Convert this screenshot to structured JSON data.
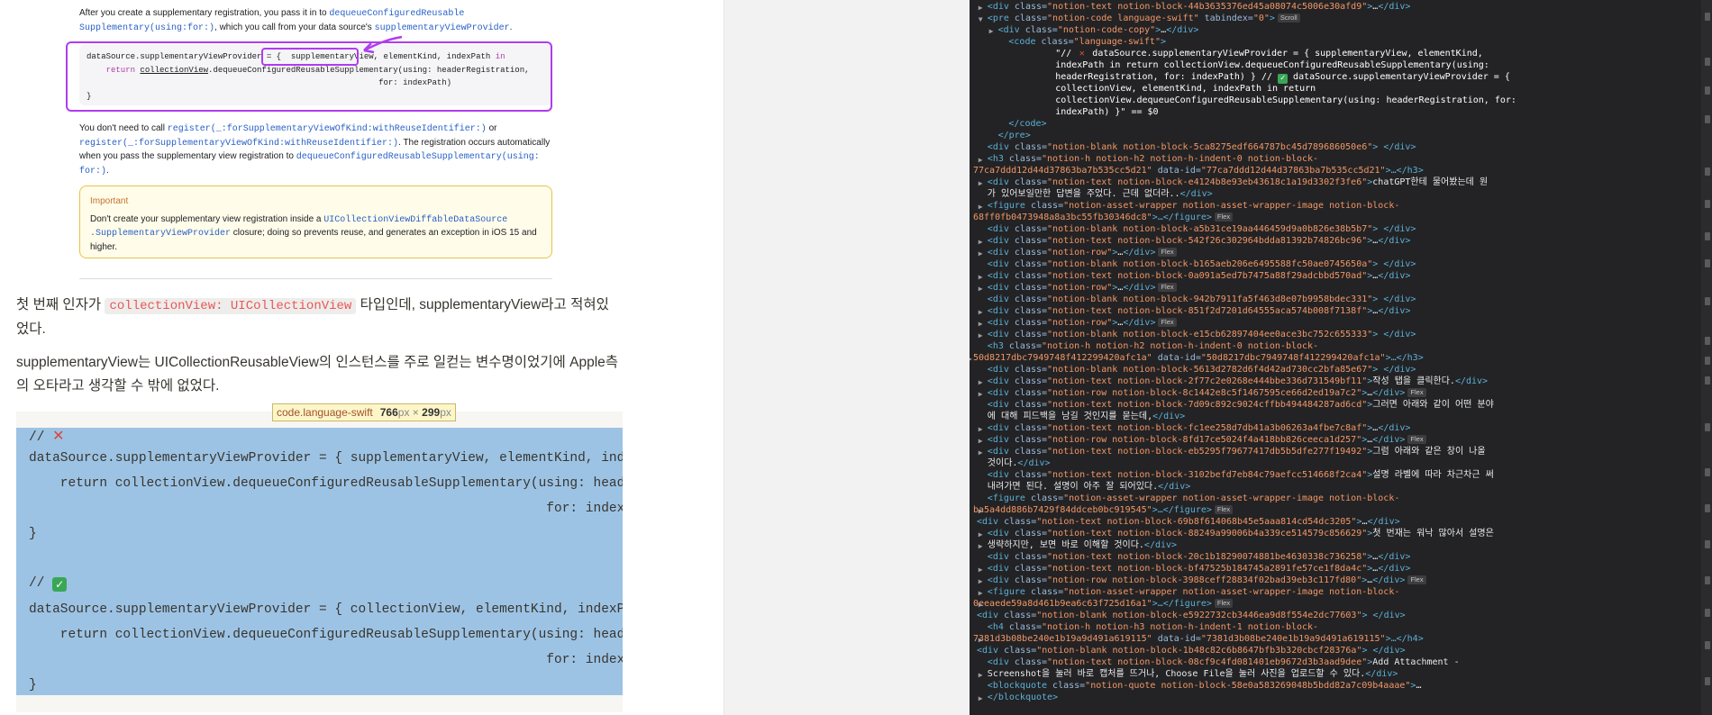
{
  "article": {
    "para1_a": "After you create a supplementary registration, you pass it in to ",
    "para1_link1": "dequeueConfiguredReusable",
    "para1_link1b": "Supplementary(using:for:)",
    "para1_b": ", which you call from your data source's ",
    "para1_link2": "supplementaryViewProvider",
    "para1_c": ".",
    "code_line1_a": "dataSource.supplementaryViewProvider = { ",
    "code_line1_hl": "supplementaryView,",
    "code_line1_b": " elementKind, indexPath ",
    "code_line1_kw": "in",
    "code_line2_kw": "return",
    "code_line2_u": "collectionView",
    "code_line2_b": ".dequeueConfiguredReusableSupplementary(using: headerRegistration,",
    "code_line3": "for: indexPath)",
    "code_line4": "}",
    "para2_a": "You don't need to call ",
    "para2_link1": "register(_:forSupplementaryViewOfKind:withReuseIdentifier:)",
    "para2_b": " or",
    "para2_link2": "register(_:forSupplementaryViewOfKind:withReuseIdentifier:)",
    "para2_c": ". The registration occurs automatically when you pass the supplementary view registration to ",
    "para2_link3": "dequeueConfiguredReusableSupplementary(using:",
    "para2_link3b": "for:)",
    "para2_d": ".",
    "important_title": "Important",
    "important_a": "Don't create your supplementary view registration inside a ",
    "important_link": "UICollectionViewDiffableDataSource",
    "important_link2": ".SupplementaryViewProvider",
    "important_b": " closure; doing so prevents reuse, and generates an exception in iOS 15 and higher.",
    "ko1_a": "첫 번째 인자가 ",
    "ko1_code": "collectionView: UICollectionView",
    "ko1_b": " 타입인데, supplementaryView라고 적혀있었다.",
    "ko2": "supplementaryView는 UICollectionReusableView의 인스턴스를 주로 일컫는 변수명이었기에 Apple측의 오타라고 생각할 수 밖에 없었다.",
    "big_code": {
      "l1_comment": "// ",
      "l2": "dataSource.supplementaryViewProvider = { supplementaryView, elementKind, indexPath in",
      "l3": "    return collectionView.dequeueConfiguredReusableSupplementary(using: headerRegistration,",
      "l4": "                                                                  for: indexPath)",
      "l5": "}",
      "l7_comment": "// ",
      "l8": "dataSource.supplementaryViewProvider = { collectionView, elementKind, indexPath in",
      "l9": "    return collectionView.dequeueConfiguredReusableSupplementary(using: headerRegistration,",
      "l10": "                                                                  for: indexPath)",
      "l11": "}"
    },
    "tooltip_selector": "code.language-swift",
    "tooltip_w": "766",
    "tooltip_h": "299",
    "tooltip_unit": "px",
    "tooltip_x": "×"
  },
  "devtools": {
    "icons": [
      "x-emoji-icon",
      "check-emoji-icon",
      "expand-triangle-icon",
      "collapse-triangle-icon"
    ],
    "colors": {
      "panel_bg": "#232325",
      "selection": "#0c4bb6",
      "tag": "#5db0d7",
      "attr_name": "#9bbbdc",
      "attr_value": "#f29766"
    },
    "lines": [
      {
        "pre": "<div ",
        "cls": "notion-text notion-block-44b3635376ed45a08074c5006e30afd9",
        "post": ">…</div>"
      },
      {
        "pre": "<pre ",
        "cls": "notion-code language-swift",
        "extra": " tabindex=\"0\">",
        "chip": "scroll"
      },
      {
        "pre": "<div ",
        "cls": "notion-code-copy",
        "post": ">…</div>"
      },
      {
        "pre": "<code ",
        "cls": "language-swift",
        "post": ">"
      },
      {
        "sel": "\"// ",
        "sel_b": " dataSource.supplementaryViewProvider = { supplementaryView, elementKind,"
      },
      {
        "sel": "indexPath in return collectionView.dequeueConfiguredReusableSupplementary(using:"
      },
      {
        "sel": "headerRegistration, for: indexPath) } // ",
        "sel_b": " dataSource.supplementaryViewProvider = {"
      },
      {
        "sel": "collectionView, elementKind, indexPath in return"
      },
      {
        "sel": "collectionView.dequeueConfiguredReusableSupplementary(using: headerRegistration, for:"
      },
      {
        "sel": "indexPath) }\" == $0"
      },
      {
        "close": "</code>"
      },
      {
        "close": "</pre>"
      },
      {
        "pre": "<div ",
        "cls": "notion-blank notion-block-5ca8275edf664787bc45d789686050e6",
        "post": "> </div>"
      },
      {
        "pre": "<h3 ",
        "cls": "notion-h notion-h2 notion-h-indent-0 notion-block-"
      },
      {
        "cont": "77ca7ddd12d44d37863ba7b535cc5d21",
        "extra_attr": " data-id=",
        "extra_val": "\"77ca7ddd12d44d37863ba7b535cc5d21\"",
        "post": ">…</h3>"
      },
      {
        "pre": "<div ",
        "cls": "notion-text notion-block-e4124b8e93eb43618c1a19d3302f3fe6",
        "post": ">chatGPT한테 물어봤는데 원"
      },
      {
        "text": "가 있어보일만한 답변을 주었다. 근데 없더라..</div>"
      },
      {
        "pre": "<figure ",
        "cls": "notion-asset-wrapper notion-asset-wrapper-image notion-block-"
      },
      {
        "cont": "68ff0fb0473948a8a3bc55fb30346dc8",
        "post": ">…</figure>",
        "chip": "flex"
      },
      {
        "pre": "<div ",
        "cls": "notion-blank notion-block-a5b31ce19aa446459d9a0b826e38b5b7",
        "post": "> </div>"
      },
      {
        "pre": "<div ",
        "cls": "notion-text notion-block-542f26c302964bdda81392b74826bc96",
        "post": ">…</div>"
      },
      {
        "pre": "<div ",
        "cls": "notion-row",
        "post": ">…</div>",
        "chip": "flex"
      },
      {
        "pre": "<div ",
        "cls": "notion-blank notion-block-b165aeb206e6495588fc50ae0745650a",
        "post": "> </div>"
      },
      {
        "pre": "<div ",
        "cls": "notion-text notion-block-0a091a5ed7b7475a88f29adcbbd570ad",
        "post": ">…</div>"
      },
      {
        "pre": "<div ",
        "cls": "notion-row",
        "post": ">…</div>",
        "chip": "flex"
      },
      {
        "pre": "<div ",
        "cls": "notion-blank notion-block-942b7911fa5f463d8e07b9958bdec331",
        "post": "> </div>"
      },
      {
        "pre": "<div ",
        "cls": "notion-text notion-block-851f2d7201d64555aca574b008f7138f",
        "post": ">…</div>"
      },
      {
        "pre": "<div ",
        "cls": "notion-row",
        "post": ">…</div>",
        "chip": "flex"
      },
      {
        "pre": "<div ",
        "cls": "notion-blank notion-block-e15cb62897404ee0ace3bc752c655333",
        "post": "> </div>"
      },
      {
        "pre": "<h3 ",
        "cls": "notion-h notion-h2 notion-h-indent-0 notion-block-"
      },
      {
        "cont": "50d8217dbc7949748f412299420afc1a",
        "extra_attr": " data-id=",
        "extra_val": "\"50d8217dbc7949748f412299420afc1a\"",
        "post": ">…</h3>"
      },
      {
        "pre": "<div ",
        "cls": "notion-blank notion-block-5613d2782d6f4d42ad730cc2bfa85e67",
        "post": "> </div>"
      },
      {
        "pre": "<div ",
        "cls": "notion-text notion-block-2f77c2e0268e444bbe336d731549bf11",
        "post": ">작성 탭을 클릭한다.</div>"
      },
      {
        "pre": "<div ",
        "cls": "notion-row notion-block-8c1442e8c5f1467595ce66d2ed19a7c2",
        "post": ">…</div>",
        "chip": "flex"
      },
      {
        "pre": "<div ",
        "cls": "notion-text notion-block-7d09c892c9024cffbb494484287ad6cd",
        "post": ">그러면 아래와 같이 어떤 분야"
      },
      {
        "text": "에 대해 피드백을 남길 것인지를 묻는데,</div>"
      },
      {
        "pre": "<div ",
        "cls": "notion-text notion-block-fc1ee258d7db41a3b06263a4fbe7c8af",
        "post": ">…</div>"
      },
      {
        "pre": "<div ",
        "cls": "notion-row notion-block-8fd17ce5024f4a418bb826ceeca1d257",
        "post": ">…</div>",
        "chip": "flex"
      },
      {
        "pre": "<div ",
        "cls": "notion-text notion-block-eb5295f79677417db5b5dfe277f19492",
        "post": ">그럼 아래와 같은 창이 나올"
      },
      {
        "text": "것이다.</div>"
      },
      {
        "pre": "<div ",
        "cls": "notion-text notion-block-3102befd7eb84c79aefcc514668f2ca4",
        "post": ">설명 라벨에 따라 차근차근 써"
      },
      {
        "text": "내려가면 된다. 설명이 아주 잘 되어있다.</div>"
      },
      {
        "pre": "<figure ",
        "cls": "notion-asset-wrapper notion-asset-wrapper-image notion-block-"
      },
      {
        "cont": "ba5a4dd886b7429f84ddceb0bc919545",
        "post": ">…</figure>",
        "chip": "flex"
      },
      {
        "pre": "<div ",
        "cls": "notion-text notion-block-69b8f614068b45e5aaa814cd54dc3205",
        "post": ">…</div>"
      },
      {
        "pre": "<div ",
        "cls": "notion-text notion-block-88249a99006b4a339ce514579c856629",
        "post": ">첫 번재는 워낙 많아서 설명은"
      },
      {
        "text": "생략하지만, 보면 바로 이해할 것이다.</div>"
      },
      {
        "pre": "<div ",
        "cls": "notion-text notion-block-20c1b18290074881be4630338c736258",
        "post": ">…</div>"
      },
      {
        "pre": "<div ",
        "cls": "notion-text notion-block-bf47525b184745a2891fe57ce1f8da4c",
        "post": ">…</div>"
      },
      {
        "pre": "<div ",
        "cls": "notion-row notion-block-3988ceff28834f02bad39eb3c117fd80",
        "post": ">…</div>",
        "chip": "flex"
      },
      {
        "pre": "<figure ",
        "cls": "notion-asset-wrapper notion-asset-wrapper-image notion-block-"
      },
      {
        "cont": "0eeaede59a8d461b9ea6c63f725d16a1",
        "post": ">…</figure>",
        "chip": "flex"
      },
      {
        "pre": "<div ",
        "cls": "notion-blank notion-block-e5922732cb3446ea9d8f554e2dc77603",
        "post": "> </div>"
      },
      {
        "pre": "<h4 ",
        "cls": "notion-h notion-h3 notion-h-indent-1 notion-block-"
      },
      {
        "cont": "7381d3b08be240e1b19a9d491a619115",
        "extra_attr": " data-id=",
        "extra_val": "\"7381d3b08be240e1b19a9d491a619115\"",
        "post": ">…</h4>"
      },
      {
        "pre": "<div ",
        "cls": "notion-blank notion-block-1b48c82c6b8647bfb3b320cbcf28376a",
        "post": "> </div>"
      },
      {
        "pre": "<div ",
        "cls": "notion-text notion-block-08cf9c4fd081401eb9672d3b3aad9dee",
        "post": ">Add Attachment -"
      },
      {
        "text": "Screenshot을 눌러 바로 캡처를 뜨거나, Choose File을 눌러 사진을 업로드할 수 있다.</div>"
      },
      {
        "pre": "<blockquote ",
        "cls": "notion-quote notion-block-58e0a583269048b5bdd82a7c09b4aaae",
        "post": ">…"
      },
      {
        "close": "</blockquote>"
      }
    ]
  }
}
